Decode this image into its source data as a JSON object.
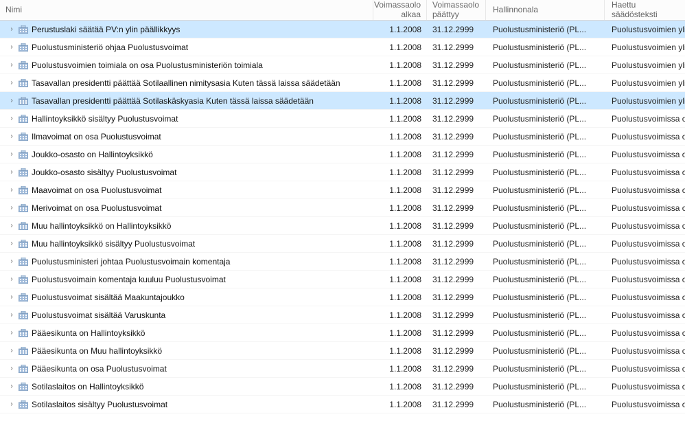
{
  "columns": {
    "name": "Nimi",
    "start": "Voimassaolo alkaa",
    "end": "Voimassaolo päättyy",
    "admin": "Hallinnonala",
    "text": "Haettu säädösteksti"
  },
  "admin_value": "Puolustusministeriö (PL...",
  "text_value_top": "Puolustusvoimien ylimma",
  "text_value_mid": "Puolustusvoimissa on pu",
  "rows": [
    {
      "name": "Perustuslaki säätää PV:n ylin päällikkyys",
      "start": "1.1.2008",
      "end": "31.12.2999",
      "text": "top",
      "selected": true
    },
    {
      "name": "Puolustusministeriö ohjaa Puolustusvoimat",
      "start": "1.1.2008",
      "end": "31.12.2999",
      "text": "top",
      "selected": false
    },
    {
      "name": "Puolustusvoimien toimiala on osa Puolustusministeriön toimiala",
      "start": "1.1.2008",
      "end": "31.12.2999",
      "text": "top",
      "selected": false
    },
    {
      "name": "Tasavallan presidentti päättää Sotilaallinen nimitysasia Kuten tässä laissa säädetään",
      "start": "1.1.2008",
      "end": "31.12.2999",
      "text": "top",
      "selected": false
    },
    {
      "name": "Tasavallan presidentti päättää Sotilaskäskyasia Kuten tässä laissa säädetään",
      "start": "1.1.2008",
      "end": "31.12.2999",
      "text": "top",
      "selected": true
    },
    {
      "name": "Hallintoyksikkö sisältyy Puolustusvoimat",
      "start": "1.1.2008",
      "end": "31.12.2999",
      "text": "mid",
      "selected": false
    },
    {
      "name": "Ilmavoimat on osa Puolustusvoimat",
      "start": "1.1.2008",
      "end": "31.12.2999",
      "text": "mid",
      "selected": false
    },
    {
      "name": "Joukko-osasto on Hallintoyksikkö",
      "start": "1.1.2008",
      "end": "31.12.2999",
      "text": "mid",
      "selected": false
    },
    {
      "name": "Joukko-osasto sisältyy Puolustusvoimat",
      "start": "1.1.2008",
      "end": "31.12.2999",
      "text": "mid",
      "selected": false
    },
    {
      "name": "Maavoimat on osa Puolustusvoimat",
      "start": "1.1.2008",
      "end": "31.12.2999",
      "text": "mid",
      "selected": false
    },
    {
      "name": "Merivoimat on osa Puolustusvoimat",
      "start": "1.1.2008",
      "end": "31.12.2999",
      "text": "mid",
      "selected": false
    },
    {
      "name": "Muu hallintoyksikkö on Hallintoyksikkö",
      "start": "1.1.2008",
      "end": "31.12.2999",
      "text": "mid",
      "selected": false
    },
    {
      "name": "Muu hallintoyksikkö sisältyy Puolustusvoimat",
      "start": "1.1.2008",
      "end": "31.12.2999",
      "text": "mid",
      "selected": false
    },
    {
      "name": "Puolustusministeri johtaa Puolustusvoimain komentaja",
      "start": "1.1.2008",
      "end": "31.12.2999",
      "text": "mid",
      "selected": false
    },
    {
      "name": "Puolustusvoimain komentaja kuuluu Puolustusvoimat",
      "start": "1.1.2008",
      "end": "31.12.2999",
      "text": "mid",
      "selected": false
    },
    {
      "name": "Puolustusvoimat sisältää Maakuntajoukko",
      "start": "1.1.2008",
      "end": "31.12.2999",
      "text": "mid",
      "selected": false
    },
    {
      "name": "Puolustusvoimat sisältää Varuskunta",
      "start": "1.1.2008",
      "end": "31.12.2999",
      "text": "mid",
      "selected": false
    },
    {
      "name": "Pääesikunta on Hallintoyksikkö",
      "start": "1.1.2008",
      "end": "31.12.2999",
      "text": "mid",
      "selected": false
    },
    {
      "name": "Pääesikunta on Muu hallintoyksikkö",
      "start": "1.1.2008",
      "end": "31.12.2999",
      "text": "mid",
      "selected": false
    },
    {
      "name": "Pääesikunta on osa Puolustusvoimat",
      "start": "1.1.2008",
      "end": "31.12.2999",
      "text": "mid",
      "selected": false
    },
    {
      "name": "Sotilaslaitos on Hallintoyksikkö",
      "start": "1.1.2008",
      "end": "31.12.2999",
      "text": "mid",
      "selected": false
    },
    {
      "name": "Sotilaslaitos sisältyy Puolustusvoimat",
      "start": "1.1.2008",
      "end": "31.12.2999",
      "text": "mid",
      "selected": false
    }
  ]
}
